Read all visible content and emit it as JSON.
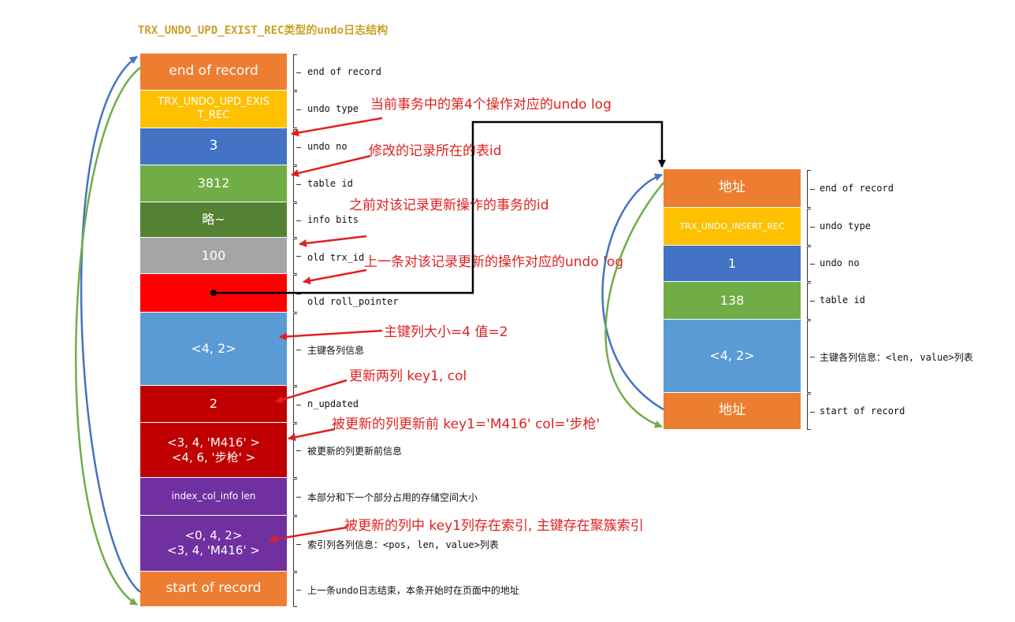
{
  "title": "TRX_UNDO_UPD_EXIST_REC类型的undo日志结构",
  "left_record": {
    "cells": [
      {
        "text": "end of record",
        "color": "#ed7d31"
      },
      {
        "text": "TRX_UNDO_UPD_EXIS\nT_REC",
        "color": "#ffc000"
      },
      {
        "text": "3",
        "color": "#4472c4"
      },
      {
        "text": "3812",
        "color": "#70ad47"
      },
      {
        "text": "略~",
        "color": "#548235"
      },
      {
        "text": "100",
        "color": "#a5a5a5"
      },
      {
        "text": "",
        "color": "#ff0000"
      },
      {
        "text": "<4, 2>",
        "color": "#5b9bd5"
      },
      {
        "text": "2",
        "color": "#c00000"
      },
      {
        "text": "<3, 4, 'M416' >\n<4, 6, '步枪' >",
        "color": "#c00000"
      },
      {
        "text": "index_col_info len",
        "color": "#7030a0"
      },
      {
        "text": "<0, 4, 2>\n<3, 4, 'M416' >",
        "color": "#7030a0"
      },
      {
        "text": "start of record",
        "color": "#ed7d31"
      }
    ],
    "labels": [
      "end of record",
      "undo type",
      "undo no",
      "table id",
      "info bits",
      "old trx_id",
      "old roll_pointer",
      "主键各列信息",
      "n_updated",
      "被更新的列更新前信息",
      "本部分和下一个部分占用的存储空间大小",
      "索引列各列信息：<pos, len, value>列表",
      "上一条undo日志结束，本条开始时在页面中的地址"
    ]
  },
  "right_record": {
    "cells": [
      {
        "text": "地址",
        "color": "#ed7d31"
      },
      {
        "text": "TRX_UNDO_INSERT_REC",
        "color": "#ffc000"
      },
      {
        "text": "1",
        "color": "#4472c4"
      },
      {
        "text": "138",
        "color": "#70ad47"
      },
      {
        "text": "<4, 2>",
        "color": "#5b9bd5"
      },
      {
        "text": "地址",
        "color": "#ed7d31"
      }
    ],
    "labels": [
      "end of record",
      "undo type",
      "undo no",
      "table id",
      "主键各列信息：<len, value>列表",
      "start of record"
    ]
  },
  "notes": [
    "当前事务中的第4个操作对应的undo log",
    "修改的记录所在的表id",
    "之前对该记录更新操作的事务的id",
    "上一条对该记录更新的操作对应的undo log",
    "主键列大小=4 值=2",
    "更新两列 key1, col",
    "被更新的列更新前 key1='M416' col='步枪'",
    "被更新的列中 key1列存在索引, 主键存在聚簇索引"
  ],
  "colors": {
    "note": "#e02020",
    "arrow": "#e02020",
    "pointer": "#000000",
    "blue_curve": "#4472c4",
    "green_curve": "#70ad47"
  }
}
